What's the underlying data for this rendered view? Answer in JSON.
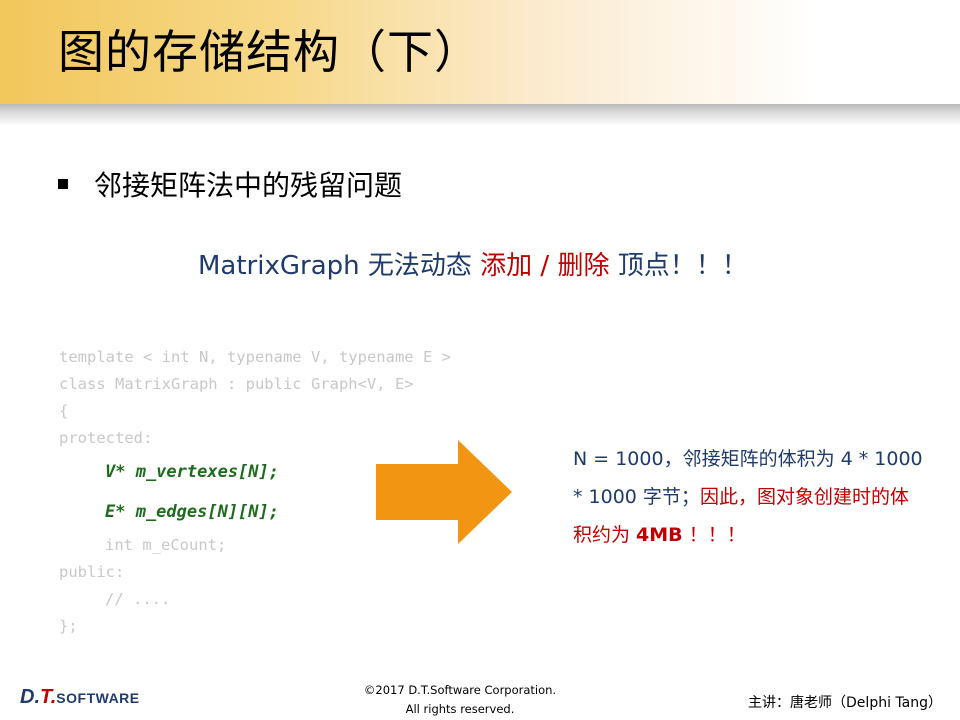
{
  "slide": {
    "title": "图的存储结构（下）",
    "bullet": "邻接矩阵法中的残留问题",
    "statement": {
      "part1": "MatrixGraph 无法动态 ",
      "part2": "添加 / 删除",
      "part3": " 顶点！！！"
    },
    "code": {
      "line1": "template < int N, typename V, typename E >",
      "line2": "class MatrixGraph : public Graph<V, E>",
      "line3": "{",
      "line4": "protected:",
      "line5": "V* m_vertexes[N];",
      "line6": "E* m_edges[N][N];",
      "line7": "int m_eCount;",
      "line8": "public:",
      "line9": "// ....",
      "line10": "};"
    },
    "explanation": {
      "part1": "N = 1000，邻接矩阵的体积为 4 * 1000 * 1000 字节；",
      "part2": "因此，图对象创建时的体积约为 ",
      "part3": "4MB",
      "part4": " ！！！"
    }
  },
  "footer": {
    "logo_d": "D.",
    "logo_t": "T.",
    "logo_soft": "SOFTWARE",
    "copyright_line1": "©2017 D.T.Software Corporation.",
    "copyright_line2": "All rights reserved.",
    "lecturer": "主讲：唐老师（Delphi Tang）"
  },
  "colors": {
    "title_band": "#f2c75b",
    "arrow": "#f29512",
    "navy": "#1f3b6e",
    "red": "#c00000",
    "code_highlight": "#1e6b1e",
    "code_faded": "#c8c8c8"
  }
}
